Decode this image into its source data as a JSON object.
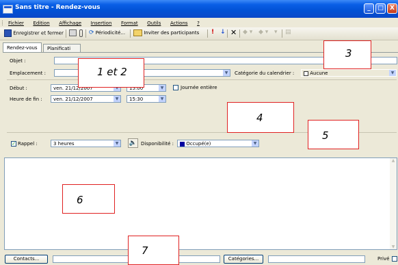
{
  "window": {
    "title": "Sans titre - Rendez-vous",
    "minimize": "_",
    "maximize": "□",
    "close": "X"
  },
  "menu": [
    "Fichier",
    "Edition",
    "Affichage",
    "Insertion",
    "Format",
    "Outils",
    "Actions",
    "?"
  ],
  "toolbar": {
    "save_close": "Enregistrer et fermer",
    "recurrence": "Périodicité...",
    "invite": "Inviter des participants"
  },
  "tabs": [
    "Rendez-vous",
    "Planificati"
  ],
  "form": {
    "subject_label": "Objet :",
    "location_label": "Emplacement :",
    "category_label": "Catégorie du calendrier :",
    "category_value": "Aucune",
    "start_label": "Début :",
    "start_date": "ven. 21/12/2007",
    "start_time": "15:00",
    "allday_label": "Journée entière",
    "end_label": "Heure de fin :",
    "end_date": "ven. 21/12/2007",
    "end_time": "15:30",
    "reminder_label": "Rappel :",
    "reminder_value": "3 heures",
    "availability_label": "Disponibilité :",
    "availability_value": "Occupé(e)"
  },
  "footer": {
    "contacts": "Contacts...",
    "categories": "Catégories...",
    "private": "Privé"
  },
  "annotations": [
    "1 et 2",
    "3",
    "4",
    "5",
    "6",
    "7"
  ],
  "colors": {
    "title_bar": "#0a5fe6",
    "annotation_border": "#e02020",
    "busy": "#0000a0"
  }
}
